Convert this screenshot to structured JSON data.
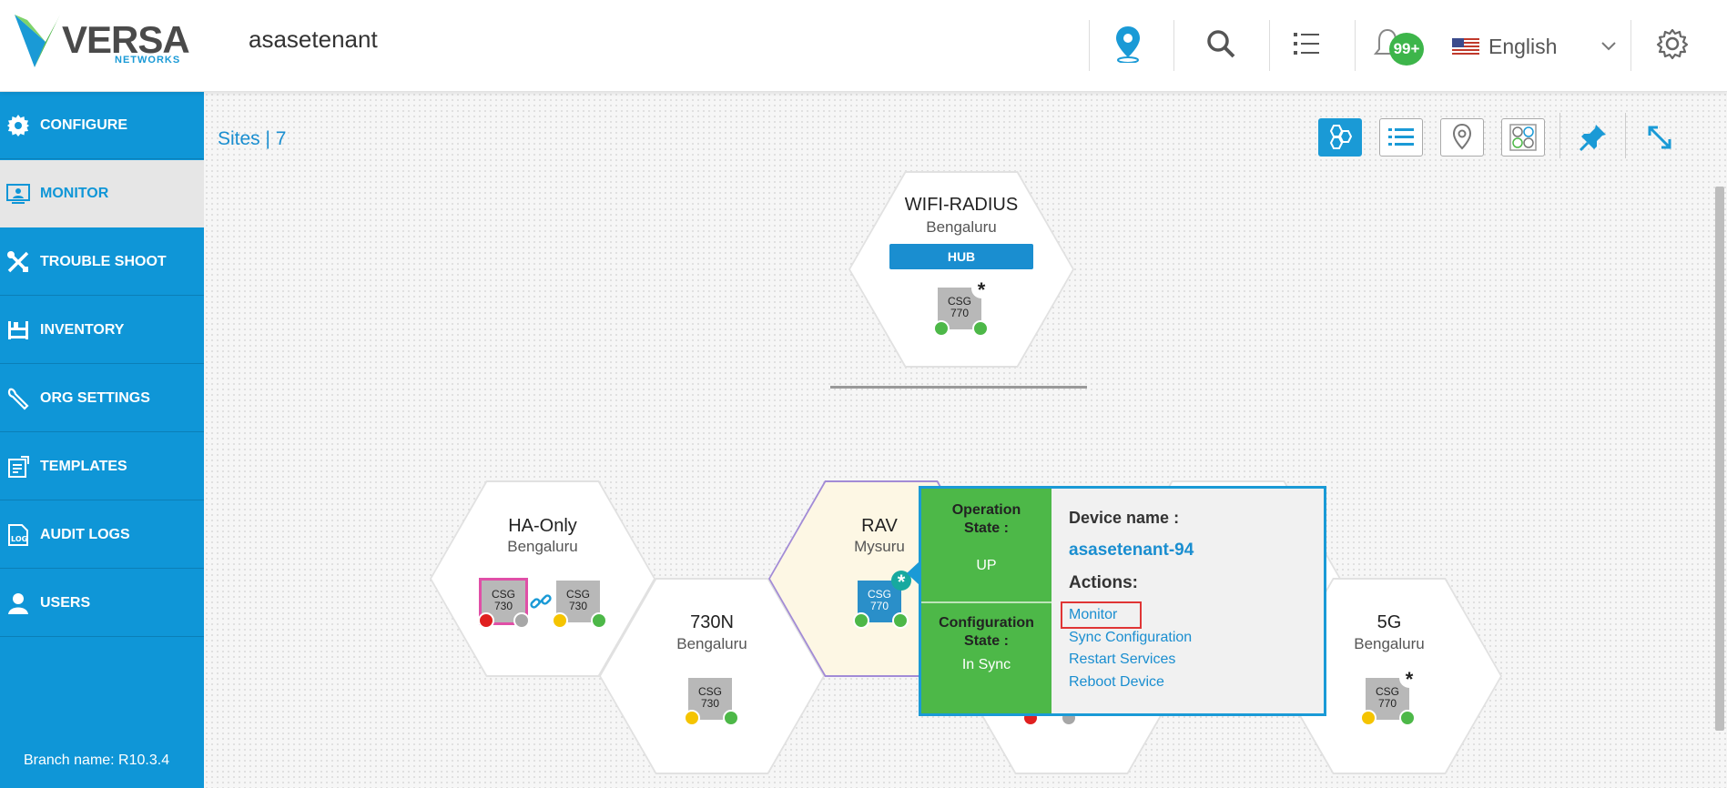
{
  "header": {
    "logo_text": "VERSA",
    "logo_subtext": "NETWORKS",
    "tenant": "asasetenant",
    "notifications_badge": "99+",
    "language": "English",
    "icons": [
      "map-pin-icon",
      "search-icon",
      "list-icon",
      "bell-icon",
      "flag-us-icon",
      "chevron-down-icon",
      "gear-icon"
    ]
  },
  "sidebar": {
    "items": [
      {
        "label": "CONFIGURE",
        "icon": "gear-icon"
      },
      {
        "label": "MONITOR",
        "icon": "monitor-icon",
        "active": true
      },
      {
        "label": "TROUBLE SHOOT",
        "icon": "tools-icon"
      },
      {
        "label": "INVENTORY",
        "icon": "inventory-icon"
      },
      {
        "label": "ORG SETTINGS",
        "icon": "wrench-icon"
      },
      {
        "label": "TEMPLATES",
        "icon": "templates-icon"
      },
      {
        "label": "AUDIT LOGS",
        "icon": "log-icon"
      },
      {
        "label": "USERS",
        "icon": "user-icon"
      }
    ],
    "branch_name": "Branch name: R10.3.4"
  },
  "main": {
    "sites_label": "Sites | 7",
    "view_buttons": [
      "hexagon-view-icon",
      "list-view-icon",
      "map-view-icon",
      "grid-view-icon",
      "pin-icon",
      "expand-icon"
    ],
    "sites": [
      {
        "name": "WIFI-RADIUS",
        "city": "Bengaluru",
        "badge": "HUB",
        "devices": [
          {
            "model": "CSG\n770"
          }
        ]
      },
      {
        "name": "HA-Only",
        "city": "Bengaluru",
        "devices": [
          {
            "model": "CSG\n730"
          },
          {
            "model": "CSG\n730"
          }
        ]
      },
      {
        "name": "730N",
        "city": "Bengaluru",
        "devices": [
          {
            "model": "CSG\n730"
          }
        ]
      },
      {
        "name": "RAV",
        "city": "Mysuru",
        "devices": [
          {
            "model": "CSG\n770"
          }
        ]
      },
      {
        "name": "5G",
        "city": "Bengaluru",
        "devices": [
          {
            "model": "CSG\n770"
          }
        ]
      }
    ]
  },
  "popup": {
    "operation_state_label": "Operation State :",
    "operation_state_value": "UP",
    "config_state_label": "Configuration State :",
    "config_state_value": "In Sync",
    "device_name_label": "Device name :",
    "device_name": "asasetenant-94",
    "actions_label": "Actions:",
    "actions": [
      "Monitor",
      "Sync Configuration",
      "Restart Services",
      "Reboot Device"
    ]
  },
  "colors": {
    "accent": "#0f96d7",
    "green_status": "#4db848",
    "yellow_status": "#f5c400",
    "red_status": "#e02020"
  }
}
